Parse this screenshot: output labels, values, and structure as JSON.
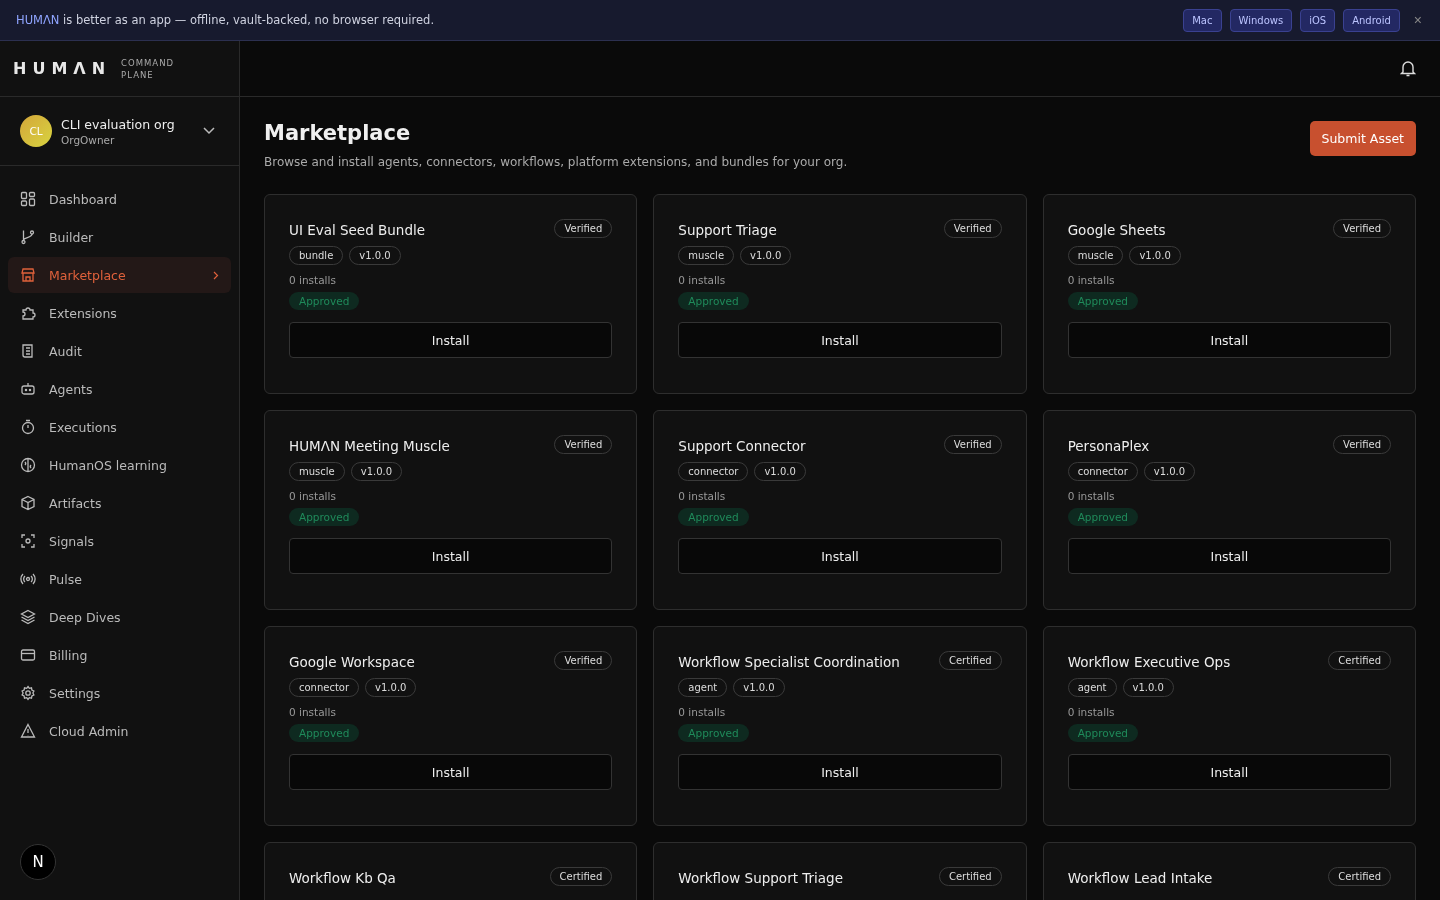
{
  "banner": {
    "brand": "HUMΛN",
    "message": "is better as an app — offline, vault-backed, no browser required.",
    "platforms": [
      "Mac",
      "Windows",
      "iOS",
      "Android"
    ],
    "close": "×"
  },
  "sidebar": {
    "logo": "HUMΛN",
    "logo_sub": [
      "COMMAND",
      "PLANE"
    ],
    "org": {
      "initials": "CL",
      "name": "CLI evaluation org",
      "role": "OrgOwner"
    },
    "items": [
      {
        "label": "Dashboard",
        "selected": false
      },
      {
        "label": "Builder",
        "selected": false
      },
      {
        "label": "Marketplace",
        "selected": true
      },
      {
        "label": "Extensions",
        "selected": false
      },
      {
        "label": "Audit",
        "selected": false
      },
      {
        "label": "Agents",
        "selected": false
      },
      {
        "label": "Executions",
        "selected": false
      },
      {
        "label": "HumanOS learning",
        "selected": false
      },
      {
        "label": "Artifacts",
        "selected": false
      },
      {
        "label": "Signals",
        "selected": false
      },
      {
        "label": "Pulse",
        "selected": false
      },
      {
        "label": "Deep Dives",
        "selected": false
      },
      {
        "label": "Billing",
        "selected": false
      },
      {
        "label": "Settings",
        "selected": false
      },
      {
        "label": "Cloud Admin",
        "selected": false
      }
    ],
    "user_initial": "N"
  },
  "page": {
    "title": "Marketplace",
    "subtitle": "Browse and install agents, connectors, workflows, platform extensions, and bundles for your org.",
    "submit_button": "Submit Asset"
  },
  "cards": [
    {
      "title": "UI Eval Seed Bundle",
      "badge": "Verified",
      "type": "bundle",
      "version": "v1.0.0",
      "installs": "0 installs",
      "status": "Approved",
      "button": "Install"
    },
    {
      "title": "Support Triage",
      "badge": "Verified",
      "type": "muscle",
      "version": "v1.0.0",
      "installs": "0 installs",
      "status": "Approved",
      "button": "Install"
    },
    {
      "title": "Google Sheets",
      "badge": "Verified",
      "type": "muscle",
      "version": "v1.0.0",
      "installs": "0 installs",
      "status": "Approved",
      "button": "Install"
    },
    {
      "title": "HUMΛN Meeting Muscle",
      "badge": "Verified",
      "type": "muscle",
      "version": "v1.0.0",
      "installs": "0 installs",
      "status": "Approved",
      "button": "Install"
    },
    {
      "title": "Support Connector",
      "badge": "Verified",
      "type": "connector",
      "version": "v1.0.0",
      "installs": "0 installs",
      "status": "Approved",
      "button": "Install"
    },
    {
      "title": "PersonaPlex",
      "badge": "Verified",
      "type": "connector",
      "version": "v1.0.0",
      "installs": "0 installs",
      "status": "Approved",
      "button": "Install"
    },
    {
      "title": "Google Workspace",
      "badge": "Verified",
      "type": "connector",
      "version": "v1.0.0",
      "installs": "0 installs",
      "status": "Approved",
      "button": "Install"
    },
    {
      "title": "Workflow Specialist Coordination",
      "badge": "Certified",
      "type": "agent",
      "version": "v1.0.0",
      "installs": "0 installs",
      "status": "Approved",
      "button": "Install"
    },
    {
      "title": "Workflow Executive Ops",
      "badge": "Certified",
      "type": "agent",
      "version": "v1.0.0",
      "installs": "0 installs",
      "status": "Approved",
      "button": "Install"
    },
    {
      "title": "Workflow Kb Qa",
      "badge": "Certified"
    },
    {
      "title": "Workflow Support Triage",
      "badge": "Certified"
    },
    {
      "title": "Workflow Lead Intake",
      "badge": "Certified"
    }
  ]
}
